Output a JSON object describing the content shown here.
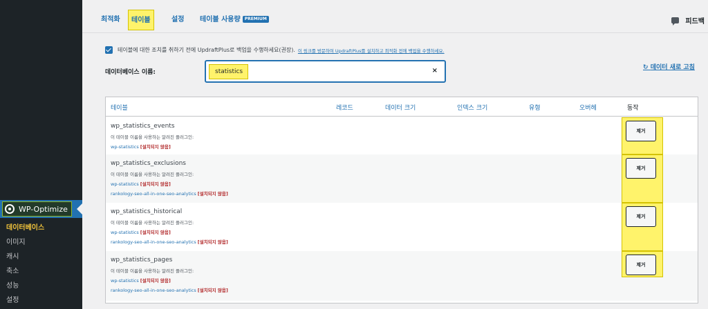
{
  "sidebar": {
    "plugin_name": "WP-Optimize",
    "items": [
      {
        "label": "데이터베이스",
        "active": true
      },
      {
        "label": "이미지",
        "active": false
      },
      {
        "label": "캐시",
        "active": false
      },
      {
        "label": "축소",
        "active": false
      },
      {
        "label": "성능",
        "active": false
      },
      {
        "label": "설정",
        "active": false
      }
    ]
  },
  "tabs": [
    {
      "label": "최적화",
      "active": false
    },
    {
      "label": "테이블",
      "active": true
    },
    {
      "label": "설정",
      "active": false
    },
    {
      "label": "테이블 사용량",
      "badge": "PREMIUM",
      "active": false
    }
  ],
  "feedback_label": "피드백",
  "backup": {
    "checked": true,
    "text": "테이블에 대한 조치를 취하기 전에 UpdraftPlus로 백업을 수행하세요(권장).",
    "link": "이 링크를 방문하여 UpdraftPlus를 설치하고 최적화 전에 백업을 수행하세요."
  },
  "database": {
    "label": "데이터베이스 이름:",
    "search_value": "statistics",
    "clear_icon": "×"
  },
  "refresh_label": "데이터 새로 고침",
  "refresh_icon": "↻",
  "table": {
    "headers": [
      "테이블",
      "레코드",
      "데이터 크기",
      "인덱스 크기",
      "유형",
      "오버헤",
      "동작"
    ],
    "used_by_label": "이 테이블 이름을 사용하는 알려진 플러그인:",
    "not_installed_label": "[설치되지 않음]",
    "action_label": "제거",
    "rows": [
      {
        "name": "wp_statistics_events",
        "plugins": [
          "wp-statistics"
        ]
      },
      {
        "name": "wp_statistics_exclusions",
        "plugins": [
          "wp-statistics",
          "rankology-seo-all-in-one-seo-analytics"
        ]
      },
      {
        "name": "wp_statistics_historical",
        "plugins": [
          "wp-statistics",
          "rankology-seo-all-in-one-seo-analytics"
        ]
      },
      {
        "name": "wp_statistics_pages",
        "plugins": [
          "wp-statistics",
          "rankology-seo-all-in-one-seo-analytics"
        ]
      }
    ]
  },
  "colors": {
    "accent": "#2271b1",
    "highlight": "#fff36b",
    "not_installed": "#b32d2e",
    "sidebar_bg": "#1d2327"
  }
}
